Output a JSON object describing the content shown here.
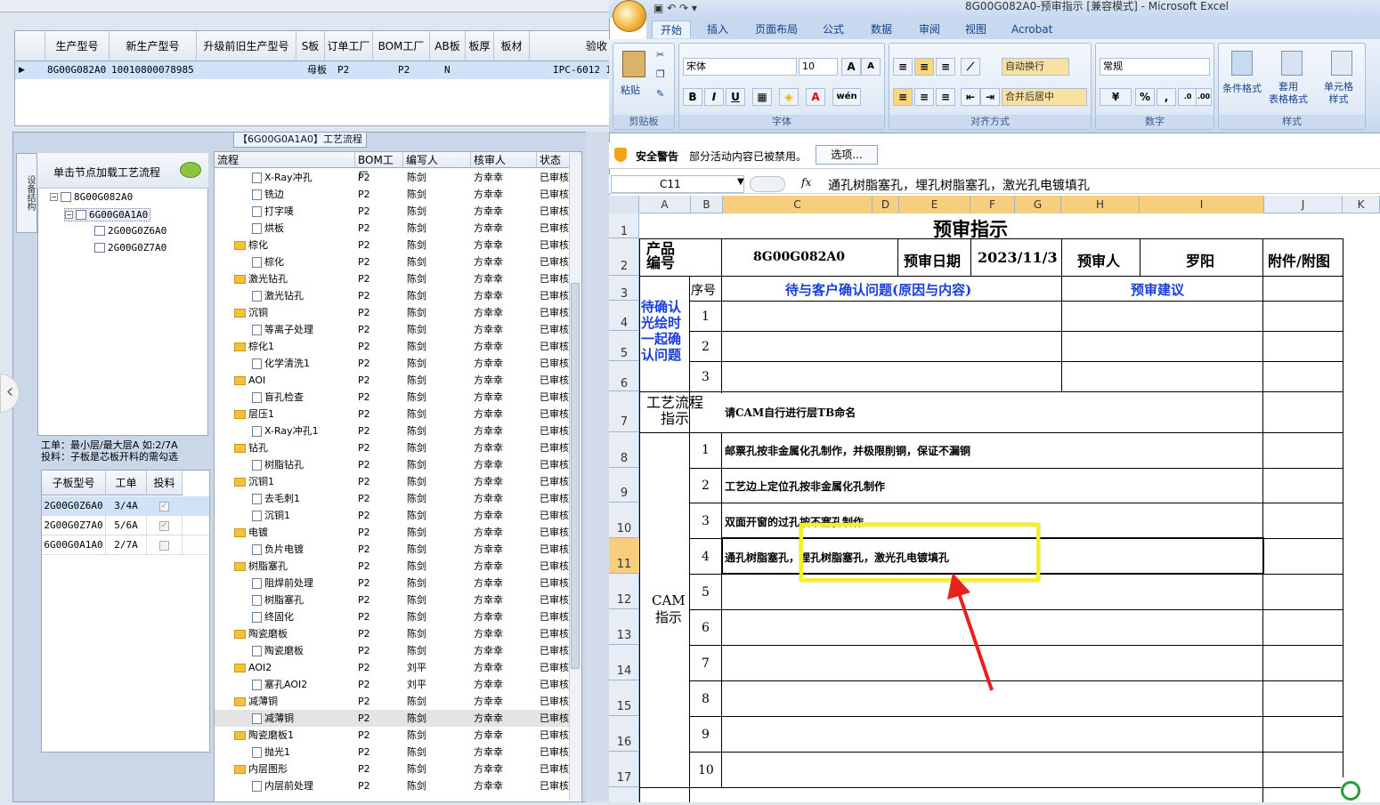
{
  "top_grid": {
    "headers": [
      "生产型号",
      "新生产型号",
      "升级前旧生产型号",
      "S板",
      "订单工厂",
      "BOM工厂",
      "AB板",
      "板厚",
      "板材",
      "验收"
    ],
    "row": [
      "8G00G082A0",
      "10010800078985",
      "",
      "母板",
      "P2",
      "P2",
      "N",
      "",
      "",
      "IPC-6012 I"
    ]
  },
  "side_tab": "设备结构",
  "tree": {
    "title": "单击节点加载工艺流程",
    "nodes": [
      "8G00G082A0",
      "6G00G0A1A0",
      "2G00G0Z6A0",
      "2G00G0Z7A0"
    ]
  },
  "info_text": [
    "工单：最小层/最大层A 如:2/7A",
    "投料：子板是芯板开料的需勾选"
  ],
  "sub_grid": {
    "headers": [
      "子板型号",
      "工单",
      "投料"
    ],
    "rows": [
      [
        "2G00G0Z6A0",
        "3/4A",
        "✓"
      ],
      [
        "2G00G0Z7A0",
        "5/6A",
        "✓"
      ],
      [
        "6G00G0A1A0",
        "2/7A",
        ""
      ]
    ]
  },
  "flow_title": "【6G00G0A1A0】工艺流程",
  "flow_grid": {
    "headers": [
      "流程",
      "BOM工厂",
      "编写人",
      "核审人",
      "状态"
    ],
    "rows": [
      {
        "n": "X-Ray冲孔",
        "lvl": 2,
        "f": "P2",
        "w": "陈剑",
        "r": "方幸幸",
        "s": "已审核"
      },
      {
        "n": "铣边",
        "lvl": 2,
        "f": "P2",
        "w": "陈剑",
        "r": "方幸幸",
        "s": "已审核"
      },
      {
        "n": "打字唛",
        "lvl": 2,
        "f": "P2",
        "w": "陈剑",
        "r": "方幸幸",
        "s": "已审核"
      },
      {
        "n": "烘板",
        "lvl": 2,
        "f": "P2",
        "w": "陈剑",
        "r": "方幸幸",
        "s": "已审核"
      },
      {
        "n": "棕化",
        "lvl": 1,
        "f": "P2",
        "w": "陈剑",
        "r": "方幸幸",
        "s": "已审核"
      },
      {
        "n": "棕化",
        "lvl": 2,
        "f": "P2",
        "w": "陈剑",
        "r": "方幸幸",
        "s": "已审核"
      },
      {
        "n": "激光钻孔",
        "lvl": 1,
        "f": "P2",
        "w": "陈剑",
        "r": "方幸幸",
        "s": "已审核"
      },
      {
        "n": "激光钻孔",
        "lvl": 2,
        "f": "P2",
        "w": "陈剑",
        "r": "方幸幸",
        "s": "已审核"
      },
      {
        "n": "沉铜",
        "lvl": 1,
        "f": "P2",
        "w": "陈剑",
        "r": "方幸幸",
        "s": "已审核"
      },
      {
        "n": "等离子处理",
        "lvl": 2,
        "f": "P2",
        "w": "陈剑",
        "r": "方幸幸",
        "s": "已审核"
      },
      {
        "n": "棕化1",
        "lvl": 1,
        "f": "P2",
        "w": "陈剑",
        "r": "方幸幸",
        "s": "已审核"
      },
      {
        "n": "化学清洗1",
        "lvl": 2,
        "f": "P2",
        "w": "陈剑",
        "r": "方幸幸",
        "s": "已审核"
      },
      {
        "n": "AOI",
        "lvl": 1,
        "f": "P2",
        "w": "陈剑",
        "r": "方幸幸",
        "s": "已审核"
      },
      {
        "n": "盲孔检查",
        "lvl": 2,
        "f": "P2",
        "w": "陈剑",
        "r": "方幸幸",
        "s": "已审核"
      },
      {
        "n": "层压1",
        "lvl": 1,
        "f": "P2",
        "w": "陈剑",
        "r": "方幸幸",
        "s": "已审核"
      },
      {
        "n": "X-Ray冲孔1",
        "lvl": 2,
        "f": "P2",
        "w": "陈剑",
        "r": "方幸幸",
        "s": "已审核"
      },
      {
        "n": "钻孔",
        "lvl": 1,
        "f": "P2",
        "w": "陈剑",
        "r": "方幸幸",
        "s": "已审核"
      },
      {
        "n": "树脂钻孔",
        "lvl": 2,
        "f": "P2",
        "w": "陈剑",
        "r": "方幸幸",
        "s": "已审核"
      },
      {
        "n": "沉铜1",
        "lvl": 1,
        "f": "P2",
        "w": "陈剑",
        "r": "方幸幸",
        "s": "已审核"
      },
      {
        "n": "去毛刺1",
        "lvl": 2,
        "f": "P2",
        "w": "陈剑",
        "r": "方幸幸",
        "s": "已审核"
      },
      {
        "n": "沉铜1",
        "lvl": 2,
        "f": "P2",
        "w": "陈剑",
        "r": "方幸幸",
        "s": "已审核"
      },
      {
        "n": "电镀",
        "lvl": 1,
        "f": "P2",
        "w": "陈剑",
        "r": "方幸幸",
        "s": "已审核"
      },
      {
        "n": "负片电镀",
        "lvl": 2,
        "f": "P2",
        "w": "陈剑",
        "r": "方幸幸",
        "s": "已审核"
      },
      {
        "n": "树脂塞孔",
        "lvl": 1,
        "f": "P2",
        "w": "陈剑",
        "r": "方幸幸",
        "s": "已审核"
      },
      {
        "n": "阻焊前处理",
        "lvl": 2,
        "f": "P2",
        "w": "陈剑",
        "r": "方幸幸",
        "s": "已审核"
      },
      {
        "n": "树脂塞孔",
        "lvl": 2,
        "f": "P2",
        "w": "陈剑",
        "r": "方幸幸",
        "s": "已审核"
      },
      {
        "n": "终固化",
        "lvl": 2,
        "f": "P2",
        "w": "陈剑",
        "r": "方幸幸",
        "s": "已审核"
      },
      {
        "n": "陶瓷磨板",
        "lvl": 1,
        "f": "P2",
        "w": "陈剑",
        "r": "方幸幸",
        "s": "已审核"
      },
      {
        "n": "陶瓷磨板",
        "lvl": 2,
        "f": "P2",
        "w": "陈剑",
        "r": "方幸幸",
        "s": "已审核"
      },
      {
        "n": "AOI2",
        "lvl": 1,
        "f": "P2",
        "w": "刘平",
        "r": "方幸幸",
        "s": "已审核"
      },
      {
        "n": "塞孔AOI2",
        "lvl": 2,
        "f": "P2",
        "w": "刘平",
        "r": "方幸幸",
        "s": "已审核"
      },
      {
        "n": "减薄铜",
        "lvl": 1,
        "f": "P2",
        "w": "陈剑",
        "r": "方幸幸",
        "s": "已审核"
      },
      {
        "n": "减薄铜",
        "lvl": 2,
        "f": "P2",
        "w": "陈剑",
        "r": "方幸幸",
        "s": "已审核"
      },
      {
        "n": "陶瓷磨板1",
        "lvl": 1,
        "f": "P2",
        "w": "陈剑",
        "r": "方幸幸",
        "s": "已审核"
      },
      {
        "n": "抛光1",
        "lvl": 2,
        "f": "P2",
        "w": "陈剑",
        "r": "方幸幸",
        "s": "已审核"
      },
      {
        "n": "内层图形",
        "lvl": 1,
        "f": "P2",
        "w": "陈剑",
        "r": "方幸幸",
        "s": "已审核"
      },
      {
        "n": "内层前处理",
        "lvl": 2,
        "f": "P2",
        "w": "陈剑",
        "r": "方幸幸",
        "s": "已审核"
      }
    ]
  },
  "excel": {
    "title": "8G00G082A0-预审指示 [兼容模式] - Microsoft Excel",
    "tabs": [
      "开始",
      "插入",
      "页面布局",
      "公式",
      "数据",
      "审阅",
      "视图",
      "Acrobat"
    ],
    "font_name": "宋体",
    "font_size": "10",
    "number_format": "常规",
    "groups": [
      "剪贴板",
      "字体",
      "对齐方式",
      "数字",
      "样式"
    ],
    "buttons": {
      "paste": "粘贴",
      "wrap": "自动换行",
      "merge": "合并后居中",
      "cond": "条件格式",
      "table": "套用\n表格格式",
      "cellstyle": "单元格\n样式"
    },
    "security_label": "安全警告",
    "security_text": "部分活动内容已被禁用。",
    "options_button": "选项...",
    "namebox": "C11",
    "fx": "fx",
    "formula": "通孔树脂塞孔，埋孔树脂塞孔，激光孔电镀填孔",
    "columns": [
      "A",
      "B",
      "C",
      "D",
      "E",
      "F",
      "G",
      "H",
      "I",
      "J",
      "K"
    ],
    "rows": [
      "1",
      "2",
      "3",
      "4",
      "5",
      "6",
      "7",
      "8",
      "9",
      "10",
      "11",
      "12",
      "13",
      "14",
      "15",
      "16",
      "17"
    ],
    "sheet": {
      "title": "预审指示",
      "product_label": "产品\n编号",
      "product": "8G00G082A0",
      "date_label": "预审日期",
      "date": "2023/11/3",
      "reviewer_label": "预审人",
      "reviewer": "罗阳",
      "attach_label": "附件/附图",
      "seq_label": "序号",
      "issue_header": "待与客户确认问题(原因与内容)",
      "suggest_header": "预审建议",
      "pending_label": "待确认\n光绘时\n一起确\n认问题",
      "pending_nums": [
        "1",
        "2",
        "3"
      ],
      "process_label": "工艺流程\n指示",
      "process_text": "请CAM自行进行层TB命名",
      "cam_label": "CAM\n指示",
      "cam_items": [
        {
          "n": "1",
          "t": "邮票孔按非金属化孔制作，并极限削铜，保证不漏铜"
        },
        {
          "n": "2",
          "t": "工艺边上定位孔按非金属化孔制作"
        },
        {
          "n": "3",
          "t": "双面开窗的过孔按不塞孔制作"
        },
        {
          "n": "4",
          "t": "通孔树脂塞孔，埋孔树脂塞孔，激光孔电镀填孔"
        },
        {
          "n": "5",
          "t": ""
        },
        {
          "n": "6",
          "t": ""
        },
        {
          "n": "7",
          "t": ""
        },
        {
          "n": "8",
          "t": ""
        },
        {
          "n": "9",
          "t": ""
        },
        {
          "n": "10",
          "t": ""
        }
      ]
    }
  },
  "colors": {
    "highlight_box": "#f5f02c",
    "arrow": "#e8201e",
    "excel_blue": "#1a3fd8"
  }
}
